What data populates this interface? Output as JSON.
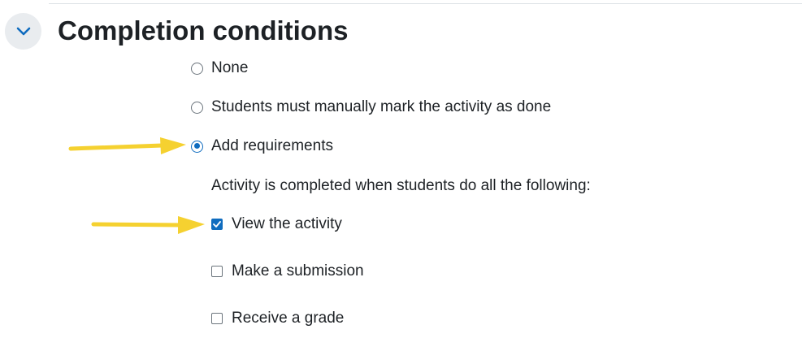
{
  "section": {
    "title": "Completion conditions",
    "toggle_icon": "chevron-down-icon"
  },
  "options": {
    "none": {
      "label": "None",
      "checked": false
    },
    "manual": {
      "label": "Students must manually mark the activity as done",
      "checked": false
    },
    "requirements": {
      "label": "Add requirements",
      "checked": true
    }
  },
  "requirements_intro": "Activity is completed when students do all the following:",
  "requirements": {
    "view": {
      "label": "View the activity",
      "checked": true
    },
    "submit": {
      "label": "Make a submission",
      "checked": false
    },
    "grade": {
      "label": "Receive a grade",
      "checked": false
    }
  },
  "colors": {
    "accent": "#0f6cbf",
    "arrow": "#f5d130",
    "text": "#1d2125",
    "toggle_bg": "#e9ecef"
  }
}
